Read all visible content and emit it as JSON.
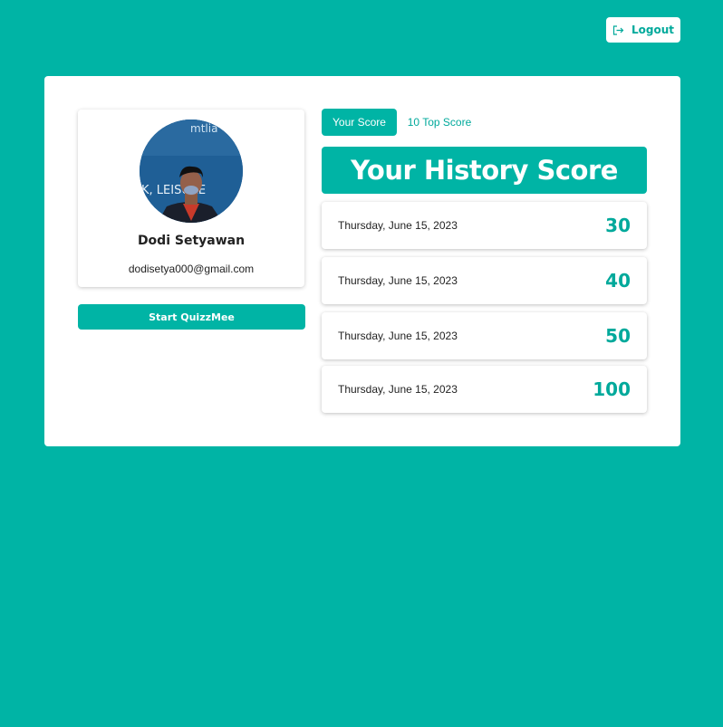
{
  "header": {
    "logout_label": "Logout",
    "logout_icon": "logout-icon"
  },
  "profile": {
    "avatar_icon": "user-photo",
    "avatar_bg_text": "mtlia",
    "avatar_bg_text2": "K, LEISURE",
    "name": "Dodi Setyawan",
    "email": "dodisetya000@gmail.com"
  },
  "actions": {
    "start_label": "Start QuizzMee"
  },
  "tabs": [
    {
      "label": "Your Score",
      "active": true
    },
    {
      "label": "10 Top Score",
      "active": false
    }
  ],
  "history": {
    "title": "Your History Score",
    "rows": [
      {
        "date": "Thursday, June 15, 2023",
        "score": "30"
      },
      {
        "date": "Thursday, June 15, 2023",
        "score": "40"
      },
      {
        "date": "Thursday, June 15, 2023",
        "score": "50"
      },
      {
        "date": "Thursday, June 15, 2023",
        "score": "100"
      }
    ]
  },
  "colors": {
    "brand": "#00b4a5",
    "accent_text": "#00a99b",
    "card": "#ffffff"
  }
}
